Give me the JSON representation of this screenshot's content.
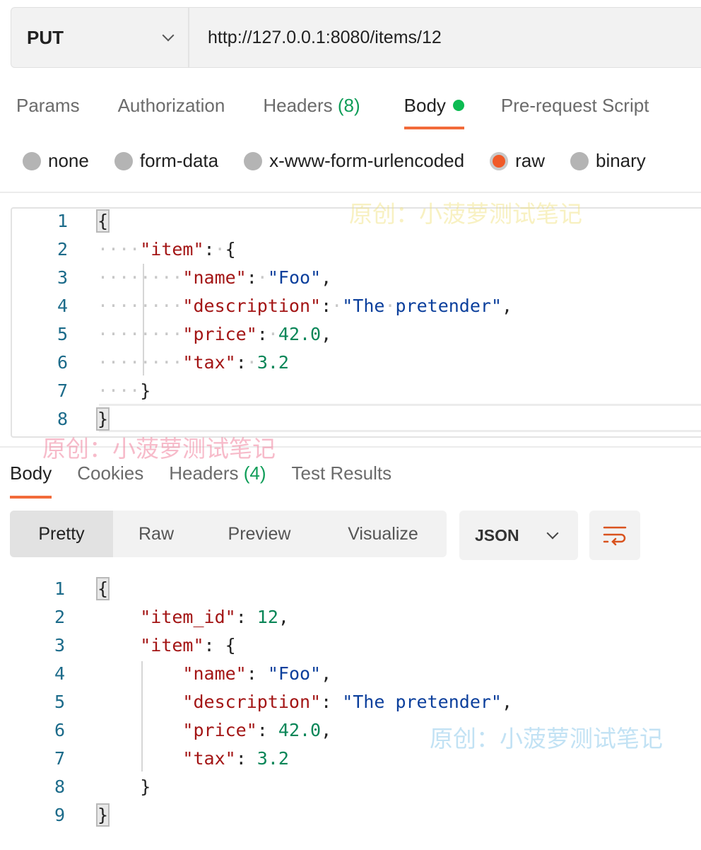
{
  "request": {
    "method": "PUT",
    "url": "http://127.0.0.1:8080/items/12"
  },
  "request_tabs": [
    {
      "label": "Params"
    },
    {
      "label": "Authorization"
    },
    {
      "label": "Headers",
      "count": "(8)"
    },
    {
      "label": "Body",
      "active": true,
      "indicator_color": "#0cbb52"
    },
    {
      "label": "Pre-request Script"
    }
  ],
  "body_types": [
    {
      "label": "none",
      "selected": false
    },
    {
      "label": "form-data",
      "selected": false
    },
    {
      "label": "x-www-form-urlencoded",
      "selected": false
    },
    {
      "label": "raw",
      "selected": true
    },
    {
      "label": "binary",
      "selected": false
    }
  ],
  "request_body_lines": [
    [
      [
        "brace",
        "{"
      ]
    ],
    [
      [
        "ws",
        "····"
      ],
      [
        "k",
        "\"item\""
      ],
      [
        "p",
        ":"
      ],
      [
        "ws",
        "·"
      ],
      [
        "p",
        "{"
      ]
    ],
    [
      [
        "ws",
        "········"
      ],
      [
        "k",
        "\"name\""
      ],
      [
        "p",
        ":"
      ],
      [
        "ws",
        "·"
      ],
      [
        "s",
        "\"Foo\""
      ],
      [
        "p",
        ","
      ]
    ],
    [
      [
        "ws",
        "········"
      ],
      [
        "k",
        "\"description\""
      ],
      [
        "p",
        ":"
      ],
      [
        "ws",
        "·"
      ],
      [
        "s",
        "\"The"
      ],
      [
        "ws",
        "·"
      ],
      [
        "s",
        "pretender\""
      ],
      [
        "p",
        ","
      ]
    ],
    [
      [
        "ws",
        "········"
      ],
      [
        "k",
        "\"price\""
      ],
      [
        "p",
        ":"
      ],
      [
        "ws",
        "·"
      ],
      [
        "n",
        "42.0"
      ],
      [
        "p",
        ","
      ]
    ],
    [
      [
        "ws",
        "········"
      ],
      [
        "k",
        "\"tax\""
      ],
      [
        "p",
        ":"
      ],
      [
        "ws",
        "·"
      ],
      [
        "n",
        "3.2"
      ]
    ],
    [
      [
        "ws",
        "····"
      ],
      [
        "p",
        "}"
      ]
    ],
    [
      [
        "brace",
        "}"
      ]
    ]
  ],
  "response_tabs": [
    {
      "label": "Body",
      "active": true
    },
    {
      "label": "Cookies"
    },
    {
      "label": "Headers",
      "count": "(4)"
    },
    {
      "label": "Test Results"
    }
  ],
  "view_modes": [
    {
      "label": "Pretty",
      "active": true
    },
    {
      "label": "Raw"
    },
    {
      "label": "Preview"
    },
    {
      "label": "Visualize"
    }
  ],
  "format": "JSON",
  "wrap_icon": "wrap-lines-icon",
  "response_body_lines": [
    [
      [
        "brace",
        "{"
      ]
    ],
    [
      [
        "p",
        "    "
      ],
      [
        "k",
        "\"item_id\""
      ],
      [
        "p",
        ": "
      ],
      [
        "n",
        "12"
      ],
      [
        "p",
        ","
      ]
    ],
    [
      [
        "p",
        "    "
      ],
      [
        "k",
        "\"item\""
      ],
      [
        "p",
        ": {"
      ]
    ],
    [
      [
        "p",
        "        "
      ],
      [
        "k",
        "\"name\""
      ],
      [
        "p",
        ": "
      ],
      [
        "s",
        "\"Foo\""
      ],
      [
        "p",
        ","
      ]
    ],
    [
      [
        "p",
        "        "
      ],
      [
        "k",
        "\"description\""
      ],
      [
        "p",
        ": "
      ],
      [
        "s",
        "\"The pretender\""
      ],
      [
        "p",
        ","
      ]
    ],
    [
      [
        "p",
        "        "
      ],
      [
        "k",
        "\"price\""
      ],
      [
        "p",
        ": "
      ],
      [
        "n",
        "42.0"
      ],
      [
        "p",
        ","
      ]
    ],
    [
      [
        "p",
        "        "
      ],
      [
        "k",
        "\"tax\""
      ],
      [
        "p",
        ": "
      ],
      [
        "n",
        "3.2"
      ]
    ],
    [
      [
        "p",
        "    "
      ],
      [
        "p",
        "}"
      ]
    ],
    [
      [
        "brace",
        "}"
      ]
    ]
  ],
  "watermark": "原创：小菠萝测试笔记",
  "colors": {
    "accent": "#f26b3a",
    "key": "#a31515",
    "string": "#0b3f9c",
    "number": "#098658",
    "line_number": "#1c6b8a"
  }
}
